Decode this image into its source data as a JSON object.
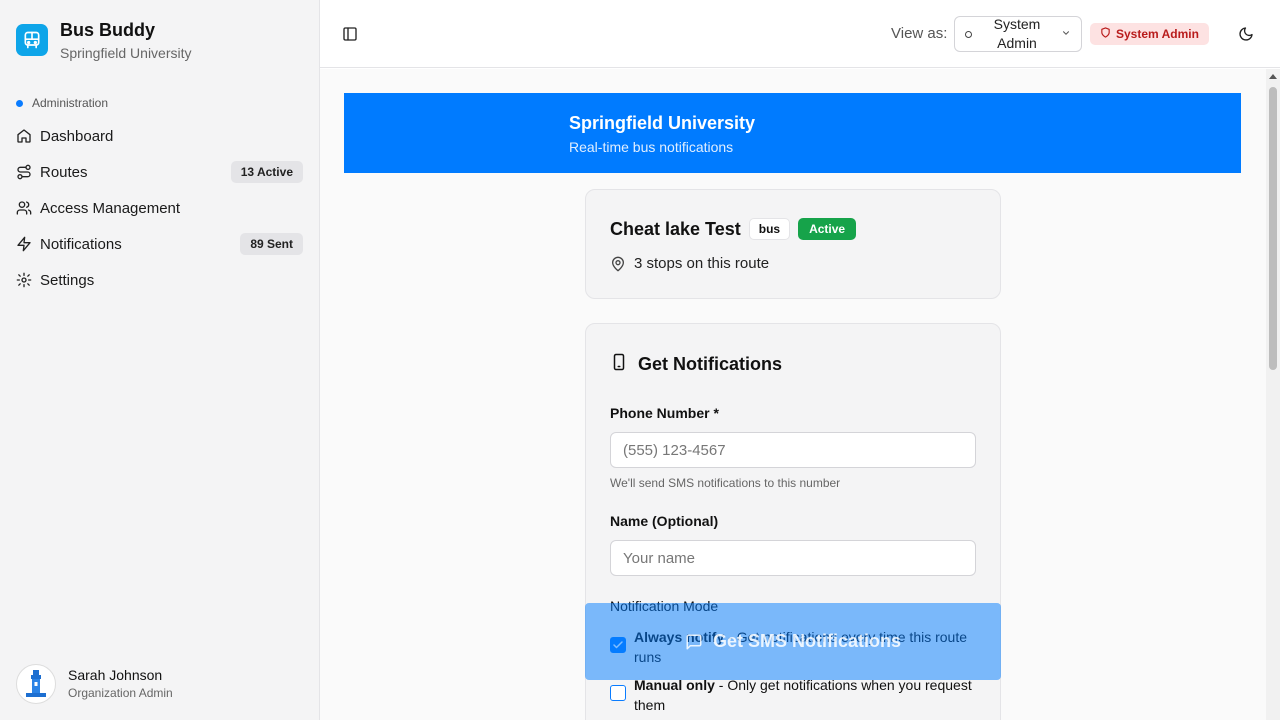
{
  "app": {
    "name": "Bus Buddy",
    "organization": "Springfield University"
  },
  "sidebar": {
    "section_label": "Administration",
    "items": [
      {
        "label": "Dashboard",
        "icon": "home-icon",
        "badge": ""
      },
      {
        "label": "Routes",
        "icon": "route-icon",
        "badge": "13 Active"
      },
      {
        "label": "Access Management",
        "icon": "users-icon",
        "badge": ""
      },
      {
        "label": "Notifications",
        "icon": "zap-icon",
        "badge": "89 Sent"
      },
      {
        "label": "Settings",
        "icon": "gear-icon",
        "badge": ""
      }
    ],
    "user": {
      "name": "Sarah Johnson",
      "role": "Organization Admin"
    }
  },
  "header": {
    "view_as_label": "View as:",
    "view_as_value": "System Admin",
    "role_badge": "System Admin"
  },
  "banner": {
    "title": "Springfield University",
    "subtitle": "Real-time bus notifications"
  },
  "route": {
    "name": "Cheat lake Test",
    "type": "bus",
    "status": "Active",
    "stops_text": "3 stops on this route"
  },
  "notifications_form": {
    "title": "Get Notifications",
    "phone_label": "Phone Number *",
    "phone_placeholder": "(555) 123-4567",
    "phone_hint": "We'll send SMS notifications to this number",
    "name_label": "Name (Optional)",
    "name_placeholder": "Your name",
    "mode_label": "Notification Mode",
    "options": [
      {
        "title": "Always notify",
        "desc": " - Get notifications every time this route runs",
        "checked": true
      },
      {
        "title": "Manual only",
        "desc": " - Only get notifications when you request them",
        "checked": false
      }
    ],
    "submit_label": "Get SMS Notifications"
  },
  "colors": {
    "primary": "#007bff",
    "active_green": "#16a34a",
    "admin_badge_bg": "#fde2e2",
    "admin_badge_text": "#b91c1c",
    "logo": "#0ea5e9"
  }
}
